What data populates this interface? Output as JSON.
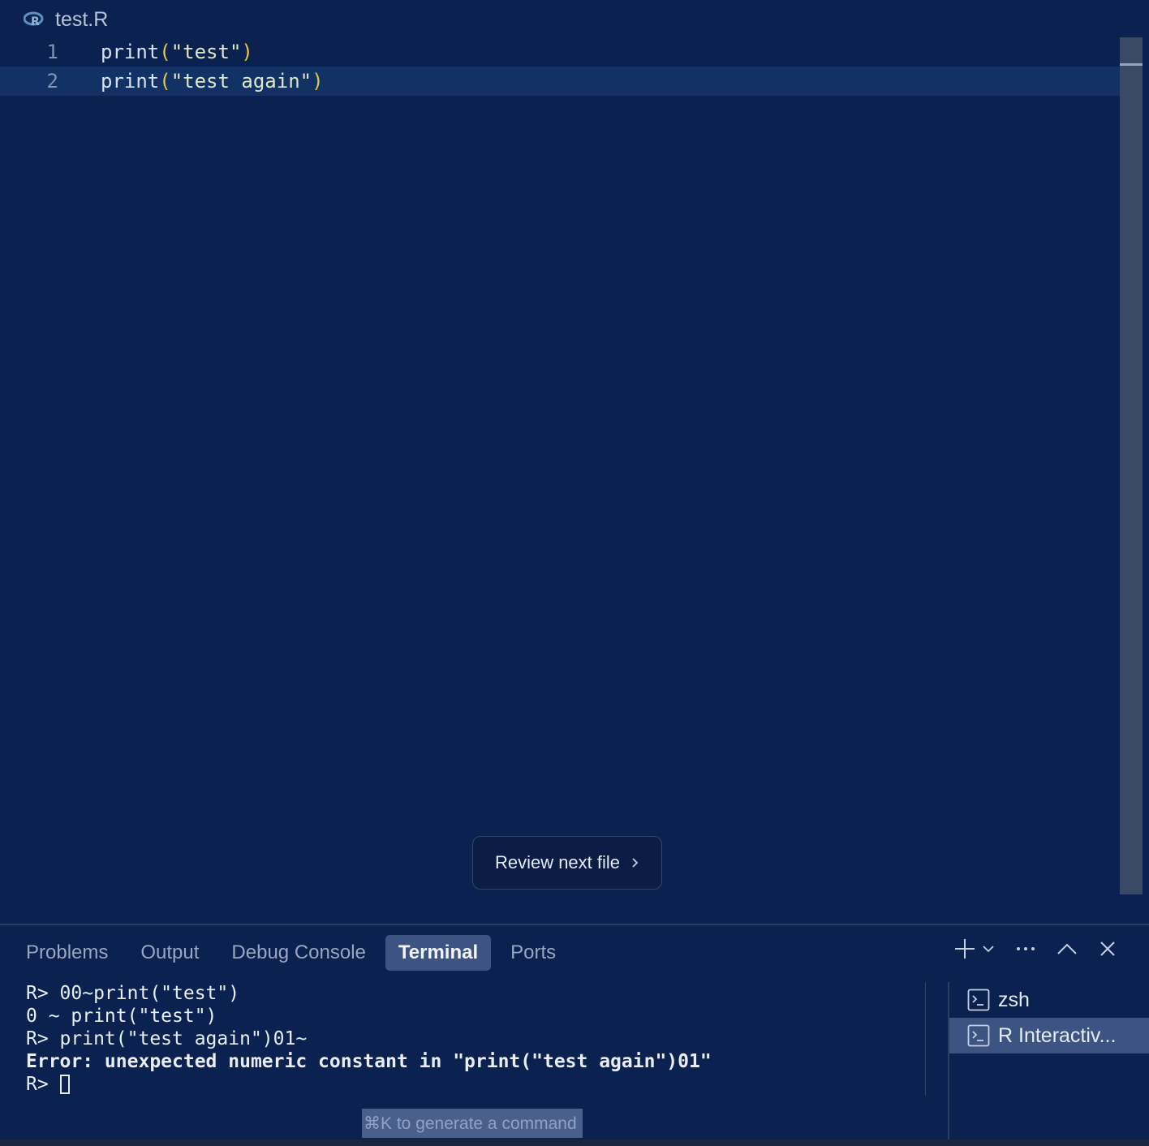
{
  "tab": {
    "icon": "r-language-icon",
    "title": "test.R"
  },
  "editor": {
    "lines": [
      {
        "number": "1",
        "fn": "print",
        "open": "(",
        "string": "\"test\"",
        "close": ")"
      },
      {
        "number": "2",
        "fn": "print",
        "open": "(",
        "string": "\"test again\"",
        "close": ")"
      }
    ]
  },
  "review_button": {
    "label": "Review next file",
    "icon": "chevron-right-icon"
  },
  "panel": {
    "tabs": [
      "Problems",
      "Output",
      "Debug Console",
      "Terminal",
      "Ports"
    ],
    "active_tab": "Terminal"
  },
  "terminal": {
    "lines": [
      "R> 00~print(\"test\")",
      "0 ~ print(\"test\")",
      "R> print(\"test again\")01~",
      "Error: unexpected numeric constant in \"print(\"test again\")01\"",
      "R> "
    ],
    "instances": [
      {
        "label": "zsh",
        "icon": "terminal-icon"
      },
      {
        "label": "R Interactiv...",
        "icon": "terminal-icon"
      }
    ],
    "selected_instance": "R Interactiv...",
    "hint": "⌘K to generate a command"
  },
  "colors": {
    "background": "#0b2150",
    "active_line": "#123266",
    "active_tab": "#3d5482",
    "string": "#dfe7c8",
    "paren": "#e7c547"
  }
}
